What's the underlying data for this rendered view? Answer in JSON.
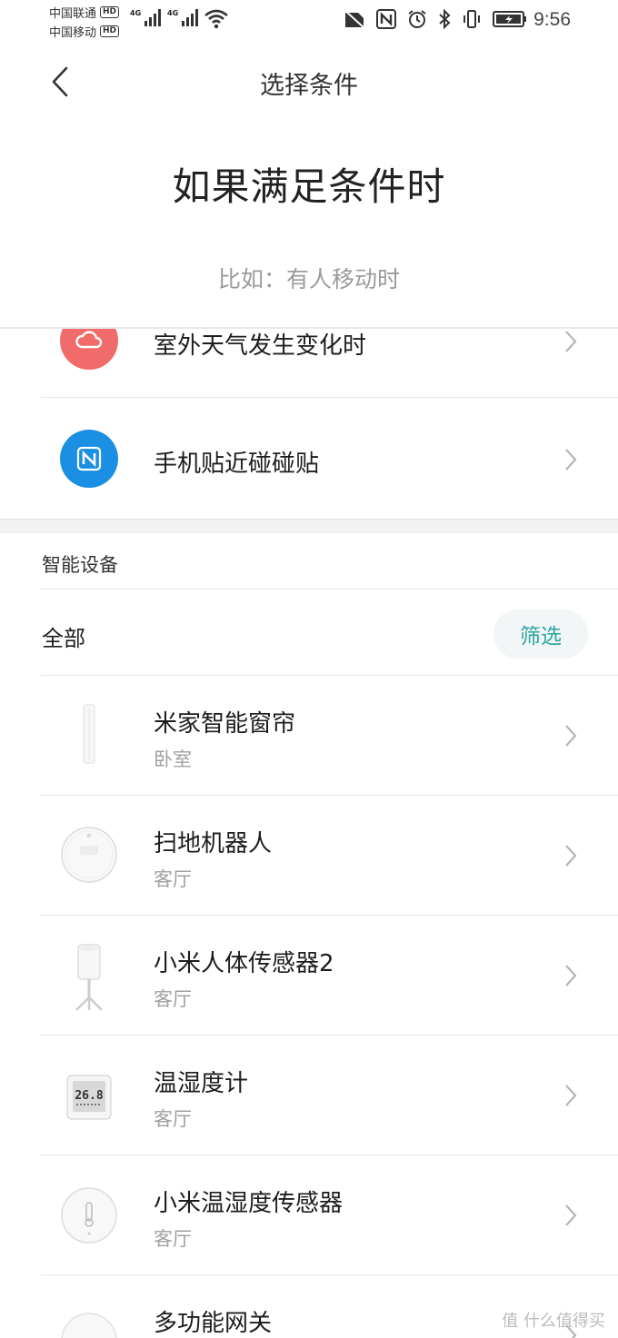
{
  "status_bar": {
    "carrier1": "中国联通",
    "carrier2": "中国移动",
    "hd": "HD",
    "net1": "4G",
    "net2": "4G",
    "time": "9:56"
  },
  "header": {
    "title": "选择条件"
  },
  "hero": {
    "title": "如果满足条件时",
    "hint": "比如：有人移动时"
  },
  "conditions": [
    {
      "label": "室外天气发生变化时",
      "icon": "weather-icon",
      "color": "#f26b6b"
    },
    {
      "label": "手机贴近碰碰贴",
      "icon": "nfc-icon",
      "color": "#1a8fe3"
    }
  ],
  "devices_section": {
    "title": "智能设备",
    "filter_all": "全部",
    "filter_button": "筛选"
  },
  "devices": [
    {
      "name": "米家智能窗帘",
      "room": "卧室",
      "icon": "curtain-icon"
    },
    {
      "name": "扫地机器人",
      "room": "客厅",
      "icon": "robot-vacuum-icon"
    },
    {
      "name": "小米人体传感器2",
      "room": "客厅",
      "icon": "motion-sensor-icon"
    },
    {
      "name": "温湿度计",
      "room": "客厅",
      "icon": "thermo-hygrometer-icon",
      "display": "26.8"
    },
    {
      "name": "小米温湿度传感器",
      "room": "客厅",
      "icon": "temp-humidity-sensor-icon"
    },
    {
      "name": "多功能网关",
      "room": "",
      "icon": "gateway-icon"
    }
  ],
  "watermark": "值 什么值得买"
}
